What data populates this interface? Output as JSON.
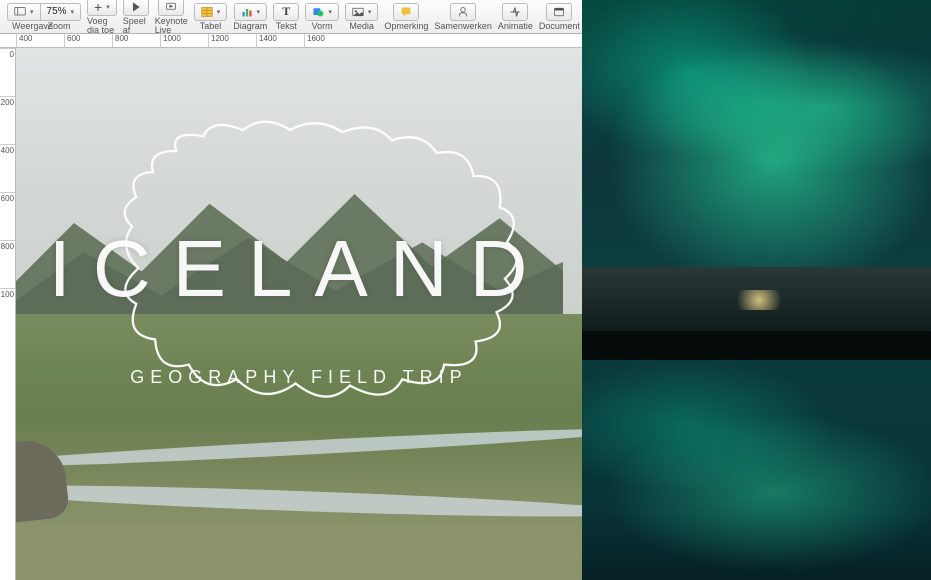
{
  "toolbar": {
    "view_label": "Weergave",
    "zoom_value": "75%",
    "zoom_label": "Zoom",
    "add_slide_label": "Voeg dia toe",
    "play_label": "Speel af",
    "keynote_live_label": "Keynote Live",
    "table_label": "Tabel",
    "chart_label": "Diagram",
    "text_label": "Tekst",
    "shape_label": "Vorm",
    "media_label": "Media",
    "comment_label": "Opmerking",
    "collaborate_label": "Samenwerken",
    "animate_label": "Animatie",
    "document_label": "Document"
  },
  "ruler_h": [
    "400",
    "600",
    "800",
    "1000",
    "1200",
    "1400",
    "1600"
  ],
  "ruler_v": [
    "0",
    "200",
    "400",
    "600",
    "800",
    "100"
  ],
  "slide": {
    "title": "ICELAND",
    "subtitle": "GEOGRAPHY FIELD TRIP"
  }
}
